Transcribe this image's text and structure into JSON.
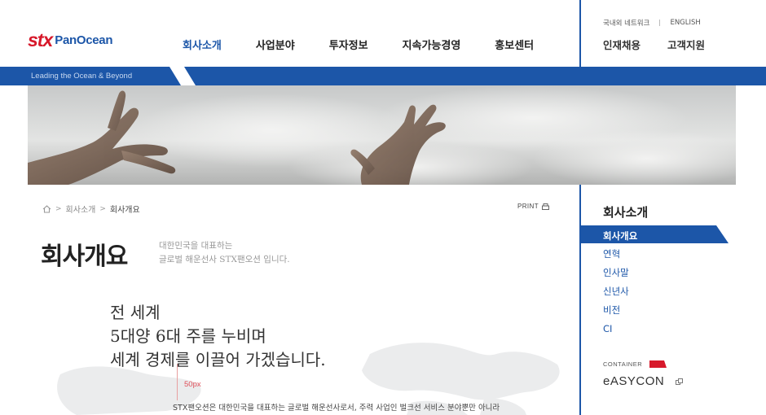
{
  "header": {
    "logo_stx": "stx",
    "logo_pan": "PanOcean",
    "nav": [
      "회사소개",
      "사업분야",
      "투자정보",
      "지속가능경영",
      "홍보센터"
    ],
    "util_top": [
      "국내외 네트워크",
      "ENGLISH"
    ],
    "util_main": [
      "인재채용",
      "고객지원"
    ]
  },
  "band": {
    "tagline": "Leading the Ocean & Beyond"
  },
  "breadcrumb": {
    "home_icon": "home-icon",
    "items": [
      "회사소개",
      "회사개요"
    ],
    "separator": ">"
  },
  "print": {
    "label": "PRINT",
    "icon": "printer-icon"
  },
  "page": {
    "title": "회사개요",
    "subtitle_lines": [
      "대한민국을 대표하는",
      "글로벌 해운선사 STX팬오션 입니다."
    ]
  },
  "content": {
    "slogan_lines": [
      "전 세계",
      "5대양 6대 주를 누비며",
      "세계 경제를 이끌어 가겠습니다."
    ],
    "marker": "50px",
    "body": "STX팬오션은 대한민국을 대표하는 글로벌 해운선사로서, 주력 사업인 벌크선 서비스 분야뿐만 아니라"
  },
  "lnb": {
    "title": "회사소개",
    "active": "회사개요",
    "items": [
      "연혁",
      "인사말",
      "신년사",
      "비전",
      "CI"
    ]
  },
  "container": {
    "label": "CONTAINER",
    "logo": "eASYCON",
    "icon": "external-link-icon"
  },
  "colors": {
    "brand_blue": "#1c56a8",
    "logo_red": "#d7192b",
    "text": "#333333"
  }
}
